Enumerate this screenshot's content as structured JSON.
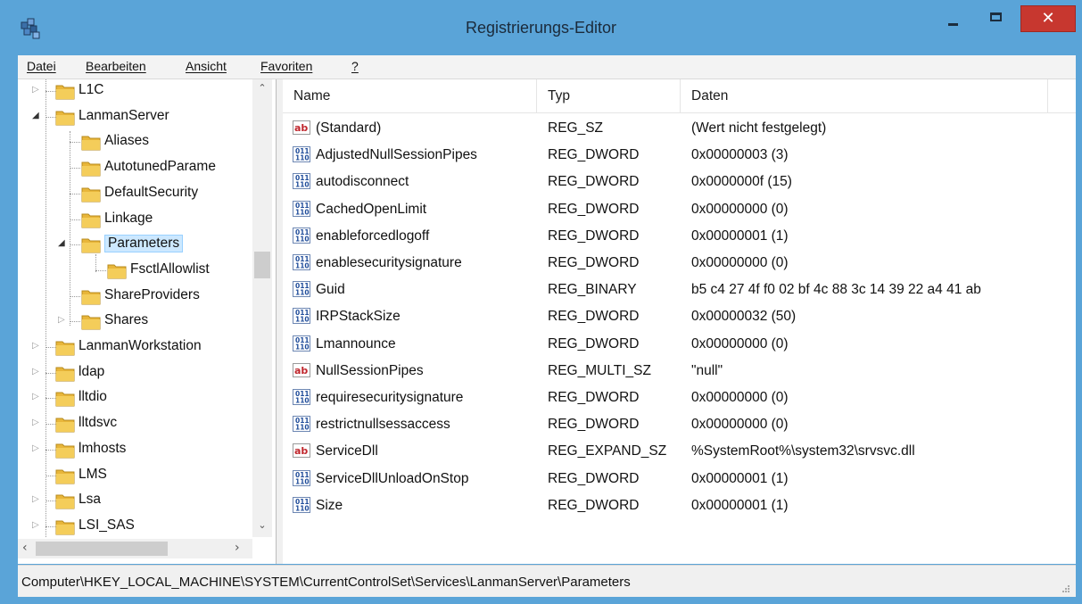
{
  "window": {
    "title": "Registrierungs-Editor",
    "close_glyph": "✕"
  },
  "menu": [
    {
      "label": "Datei"
    },
    {
      "label": "Bearbeiten"
    },
    {
      "label": "Ansicht"
    },
    {
      "label": "Favoriten"
    },
    {
      "label": "?"
    }
  ],
  "tree": [
    {
      "label": "L1C",
      "level": 0,
      "expander": "collapsed"
    },
    {
      "label": "LanmanServer",
      "level": 0,
      "expander": "expanded"
    },
    {
      "label": "Aliases",
      "level": 1,
      "expander": "none"
    },
    {
      "label": "AutotunedParame",
      "level": 1,
      "expander": "none"
    },
    {
      "label": "DefaultSecurity",
      "level": 1,
      "expander": "none"
    },
    {
      "label": "Linkage",
      "level": 1,
      "expander": "none"
    },
    {
      "label": "Parameters",
      "level": 1,
      "expander": "expanded",
      "selected": true
    },
    {
      "label": "FsctlAllowlist",
      "level": 2,
      "expander": "none"
    },
    {
      "label": "ShareProviders",
      "level": 1,
      "expander": "none"
    },
    {
      "label": "Shares",
      "level": 1,
      "expander": "collapsed"
    },
    {
      "label": "LanmanWorkstation",
      "level": 0,
      "expander": "collapsed"
    },
    {
      "label": "ldap",
      "level": 0,
      "expander": "collapsed"
    },
    {
      "label": "lltdio",
      "level": 0,
      "expander": "collapsed"
    },
    {
      "label": "lltdsvc",
      "level": 0,
      "expander": "collapsed"
    },
    {
      "label": "lmhosts",
      "level": 0,
      "expander": "collapsed"
    },
    {
      "label": "LMS",
      "level": 0,
      "expander": "none"
    },
    {
      "label": "Lsa",
      "level": 0,
      "expander": "collapsed"
    },
    {
      "label": "LSI_SAS",
      "level": 0,
      "expander": "collapsed"
    }
  ],
  "list": {
    "columns": [
      "Name",
      "Typ",
      "Daten"
    ],
    "rows": [
      {
        "icon": "string-value-icon",
        "name": "(Standard)",
        "type": "REG_SZ",
        "data": "(Wert nicht festgelegt)"
      },
      {
        "icon": "binary-value-icon",
        "name": "AdjustedNullSessionPipes",
        "type": "REG_DWORD",
        "data": "0x00000003 (3)"
      },
      {
        "icon": "binary-value-icon",
        "name": "autodisconnect",
        "type": "REG_DWORD",
        "data": "0x0000000f (15)"
      },
      {
        "icon": "binary-value-icon",
        "name": "CachedOpenLimit",
        "type": "REG_DWORD",
        "data": "0x00000000 (0)"
      },
      {
        "icon": "binary-value-icon",
        "name": "enableforcedlogoff",
        "type": "REG_DWORD",
        "data": "0x00000001 (1)"
      },
      {
        "icon": "binary-value-icon",
        "name": "enablesecuritysignature",
        "type": "REG_DWORD",
        "data": "0x00000000 (0)"
      },
      {
        "icon": "binary-value-icon",
        "name": "Guid",
        "type": "REG_BINARY",
        "data": "b5 c4 27 4f f0 02 bf 4c 88 3c 14 39 22 a4 41 ab"
      },
      {
        "icon": "binary-value-icon",
        "name": "IRPStackSize",
        "type": "REG_DWORD",
        "data": "0x00000032 (50)"
      },
      {
        "icon": "binary-value-icon",
        "name": "Lmannounce",
        "type": "REG_DWORD",
        "data": "0x00000000 (0)"
      },
      {
        "icon": "string-value-icon",
        "name": "NullSessionPipes",
        "type": "REG_MULTI_SZ",
        "data": "\"null\""
      },
      {
        "icon": "binary-value-icon",
        "name": "requiresecuritysignature",
        "type": "REG_DWORD",
        "data": "0x00000000 (0)"
      },
      {
        "icon": "binary-value-icon",
        "name": "restrictnullsessaccess",
        "type": "REG_DWORD",
        "data": "0x00000000 (0)"
      },
      {
        "icon": "string-value-icon",
        "name": "ServiceDll",
        "type": "REG_EXPAND_SZ",
        "data": "%SystemRoot%\\system32\\srvsvc.dll"
      },
      {
        "icon": "binary-value-icon",
        "name": "ServiceDllUnloadOnStop",
        "type": "REG_DWORD",
        "data": "0x00000001 (1)"
      },
      {
        "icon": "binary-value-icon",
        "name": "Size",
        "type": "REG_DWORD",
        "data": "0x00000001 (1)"
      }
    ]
  },
  "status": {
    "path": "Computer\\HKEY_LOCAL_MACHINE\\SYSTEM\\CurrentControlSet\\Services\\LanmanServer\\Parameters"
  },
  "colors": {
    "titlebar": "#5aa4d8",
    "close": "#c7372f",
    "selection": "#cce8ff",
    "folder": "#e8b63a"
  }
}
